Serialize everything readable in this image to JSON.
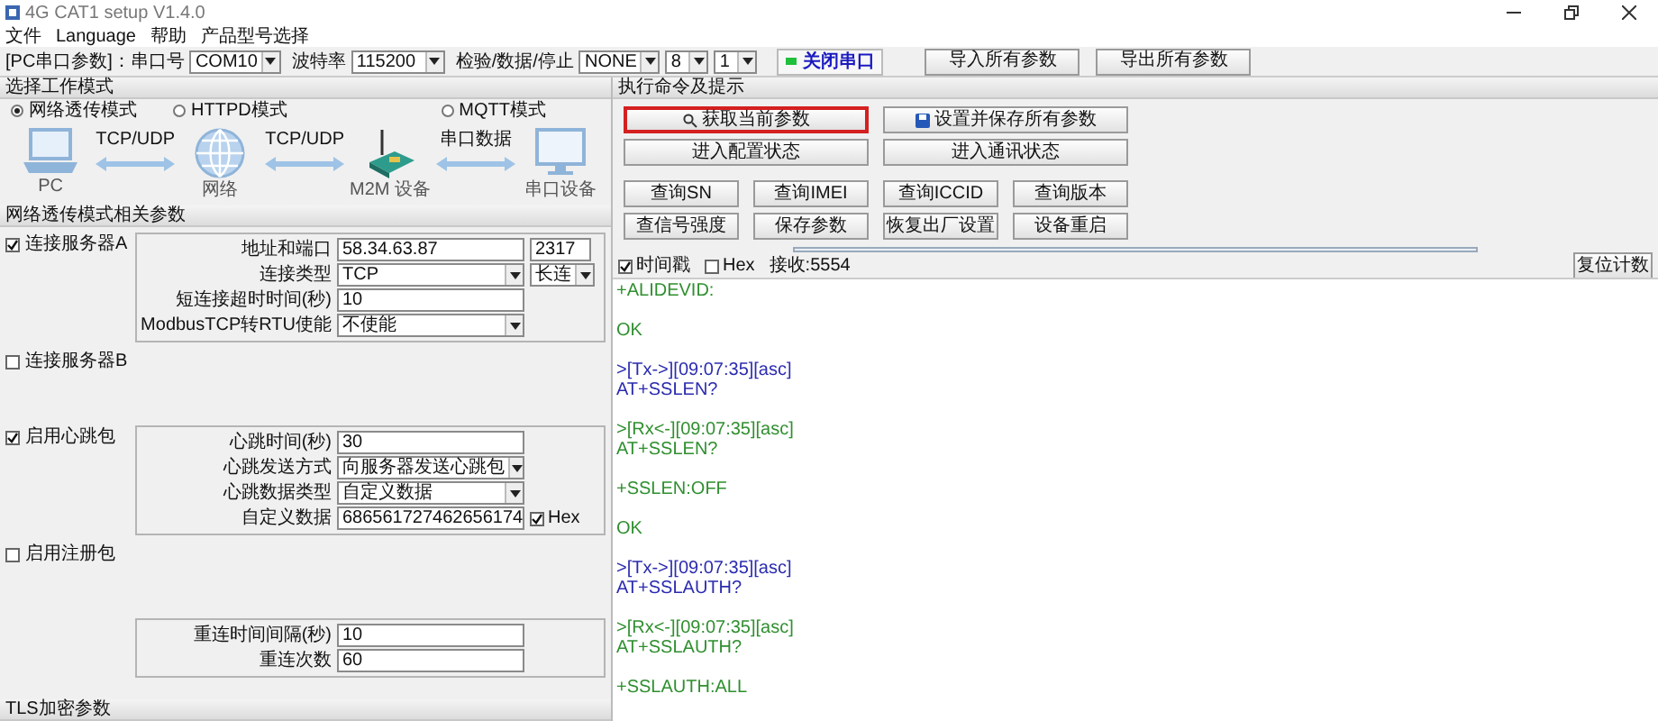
{
  "window": {
    "title": "4G CAT1 setup V1.4.0"
  },
  "menu": [
    "文件",
    "Language",
    "帮助",
    "产品型号选择"
  ],
  "toolbar": {
    "port_label": "[PC串口参数]：串口号",
    "port": "COM10",
    "baud_label": "波特率",
    "baud": "115200",
    "format_label": "检验/数据/停止",
    "parity": "NONE",
    "data_bits": "8",
    "stop_bits": "1",
    "serial_button": {
      "label": "关闭串口",
      "on": true
    },
    "import_button": "导入所有参数",
    "export_button": "导出所有参数"
  },
  "work_mode": {
    "title": "选择工作模式",
    "modes": [
      {
        "label": "网络透传模式",
        "selected": true
      },
      {
        "label": "HTTPD模式",
        "selected": false
      },
      {
        "label": "MQTT模式",
        "selected": false
      }
    ],
    "diagram": {
      "nodes": [
        "PC",
        "网络",
        "M2M 设备",
        "串口设备"
      ],
      "links": [
        "TCP/UDP",
        "TCP/UDP",
        "串口数据"
      ]
    }
  },
  "params": {
    "title": "网络透传模式相关参数",
    "groups": [
      {
        "label": "连接服务器A",
        "checked": true,
        "fields": [
          {
            "label": "地址和端口",
            "kind": "text",
            "value": "58.34.63.87",
            "extra": {
              "kind": "text",
              "value": "2317"
            }
          },
          {
            "label": "连接类型",
            "kind": "select",
            "value": "TCP",
            "extra": {
              "kind": "select",
              "value": "长连"
            }
          },
          {
            "label": "短连接超时时间(秒)",
            "kind": "text",
            "value": "10"
          },
          {
            "label": "ModbusTCP转RTU使能",
            "kind": "select",
            "value": "不使能"
          }
        ]
      },
      {
        "label": "连接服务器B",
        "checked": false
      },
      {
        "label": "启用心跳包",
        "checked": true,
        "fields": [
          {
            "label": "心跳时间(秒)",
            "kind": "text",
            "value": "30"
          },
          {
            "label": "心跳发送方式",
            "kind": "select",
            "value": "向服务器发送心跳包"
          },
          {
            "label": "心跳数据类型",
            "kind": "select",
            "value": "自定义数据"
          },
          {
            "label": "自定义数据",
            "kind": "text",
            "value": "686561727462656174",
            "extra": {
              "kind": "checkbox",
              "value": "Hex",
              "checked": true
            }
          }
        ]
      },
      {
        "label": "启用注册包",
        "checked": false
      },
      {
        "fields": [
          {
            "label": "重连时间间隔(秒)",
            "kind": "text",
            "value": "10"
          },
          {
            "label": "重连次数",
            "kind": "text",
            "value": "60"
          }
        ]
      }
    ]
  },
  "tls": {
    "title": "TLS加密参数"
  },
  "commands": {
    "title": "执行命令及提示",
    "rows": [
      [
        {
          "kind": "search",
          "label": "获取当前参数",
          "highlighted": true
        },
        {
          "kind": "save",
          "label": "设置并保存所有参数",
          "highlighted": false
        }
      ],
      [
        {
          "kind": "plain",
          "label": "进入配置状态",
          "highlighted": false
        },
        {
          "kind": "plain",
          "label": "进入通讯状态",
          "highlighted": false
        }
      ],
      [
        {
          "label": "查询SN",
          "highlighted": false
        },
        {
          "label": "查询IMEI",
          "highlighted": false
        },
        {
          "label": "查询ICCID",
          "highlighted": false
        },
        {
          "label": "查询版本",
          "highlighted": false
        }
      ],
      [
        {
          "label": "查信号强度",
          "highlighted": false
        },
        {
          "label": "保存参数",
          "highlighted": false
        },
        {
          "label": "恢复出厂设置",
          "highlighted": false
        },
        {
          "label": "设备重启",
          "highlighted": false
        }
      ]
    ]
  },
  "receive": {
    "timestamp": {
      "label": "时间戳",
      "checked": true
    },
    "hex": {
      "label": "Hex",
      "checked": false
    },
    "count": "接收:5554",
    "reset_button": "复位计数"
  },
  "log": [
    {
      "kind": "rx",
      "lines": [
        "+ALIDEVID:"
      ]
    },
    {
      "kind": "rx",
      "lines": [
        "OK"
      ]
    },
    {
      "kind": "tx",
      "lines": [
        ">[Tx->][09:07:35][asc]",
        "AT+SSLEN?"
      ]
    },
    {
      "kind": "rx",
      "lines": [
        ">[Rx<-][09:07:35][asc]",
        "AT+SSLEN?"
      ]
    },
    {
      "kind": "rx",
      "lines": [
        "+SSLEN:OFF"
      ]
    },
    {
      "kind": "rx",
      "lines": [
        "OK"
      ]
    },
    {
      "kind": "tx",
      "lines": [
        ">[Tx->][09:07:35][asc]",
        "AT+SSLAUTH?"
      ]
    },
    {
      "kind": "rx",
      "lines": [
        ">[Rx<-][09:07:35][asc]",
        "AT+SSLAUTH?"
      ]
    },
    {
      "kind": "rx",
      "lines": [
        "+SSLAUTH:ALL"
      ]
    }
  ]
}
